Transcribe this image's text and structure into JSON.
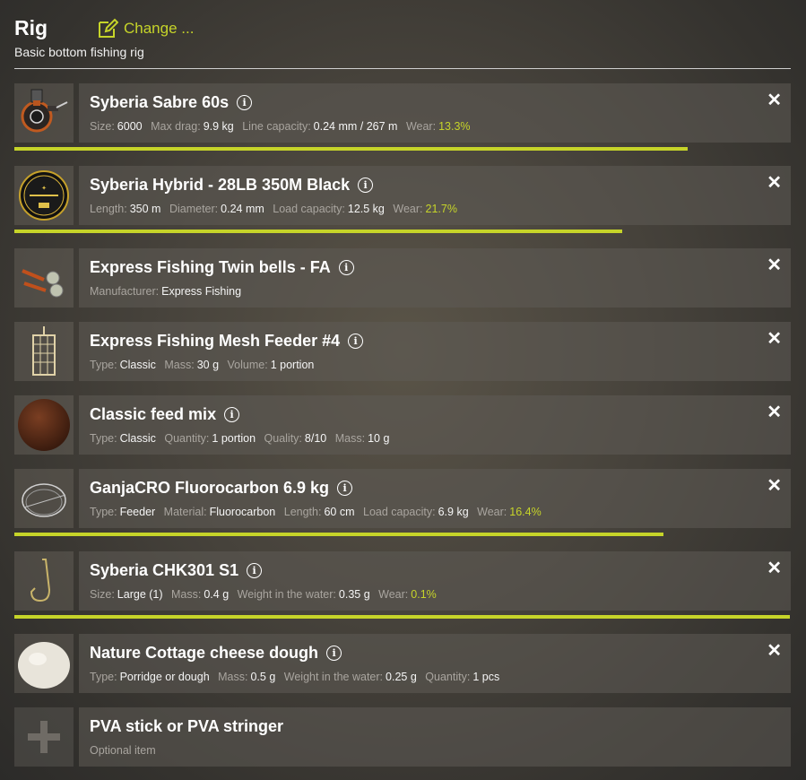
{
  "header": {
    "title": "Rig",
    "change_label": "Change ...",
    "subtitle": "Basic bottom fishing rig"
  },
  "accent_color": "#c6d429",
  "items": [
    {
      "name": "Syberia Sabre 60s",
      "icon": "reel-icon",
      "wear": 0.867,
      "specs": [
        {
          "label": "Size:",
          "value": "6000"
        },
        {
          "label": "Max drag:",
          "value": "9.9 kg"
        },
        {
          "label": "Line capacity:",
          "value": "0.24 mm / 267 m"
        },
        {
          "label": "Wear:",
          "value": "13.3%",
          "wear": true
        }
      ]
    },
    {
      "name": "Syberia Hybrid - 28LB 350M Black",
      "icon": "line-spool-icon",
      "wear": 0.783,
      "specs": [
        {
          "label": "Length:",
          "value": "350 m"
        },
        {
          "label": "Diameter:",
          "value": "0.24 mm"
        },
        {
          "label": "Load capacity:",
          "value": "12.5 kg"
        },
        {
          "label": "Wear:",
          "value": "21.7%",
          "wear": true
        }
      ]
    },
    {
      "name": "Express Fishing Twin bells - FA",
      "icon": "bells-icon",
      "specs": [
        {
          "label": "Manufacturer:",
          "value": "Express Fishing"
        }
      ]
    },
    {
      "name": "Express Fishing Mesh Feeder #4",
      "icon": "feeder-icon",
      "specs": [
        {
          "label": "Type:",
          "value": "Classic"
        },
        {
          "label": "Mass:",
          "value": "30 g"
        },
        {
          "label": "Volume:",
          "value": "1 portion"
        }
      ]
    },
    {
      "name": "Classic feed mix",
      "icon": "feed-mix-icon",
      "specs": [
        {
          "label": "Type:",
          "value": "Classic"
        },
        {
          "label": "Quantity:",
          "value": "1 portion"
        },
        {
          "label": "Quality:",
          "value": "8/10"
        },
        {
          "label": "Mass:",
          "value": "10 g"
        }
      ]
    },
    {
      "name": "GanjaCRO Fluorocarbon 6.9 kg",
      "icon": "leader-icon",
      "wear": 0.836,
      "specs": [
        {
          "label": "Type:",
          "value": "Feeder"
        },
        {
          "label": "Material:",
          "value": "Fluorocarbon"
        },
        {
          "label": "Length:",
          "value": "60 cm"
        },
        {
          "label": "Load capacity:",
          "value": "6.9 kg"
        },
        {
          "label": "Wear:",
          "value": "16.4%",
          "wear": true
        }
      ]
    },
    {
      "name": "Syberia CHK301 S1",
      "icon": "hook-icon",
      "wear": 0.999,
      "specs": [
        {
          "label": "Size:",
          "value": "Large (1)"
        },
        {
          "label": "Mass:",
          "value": "0.4 g"
        },
        {
          "label": "Weight in the water:",
          "value": "0.35 g"
        },
        {
          "label": "Wear:",
          "value": "0.1%",
          "wear": true
        }
      ]
    },
    {
      "name": "Nature Cottage cheese dough",
      "icon": "dough-bait-icon",
      "specs": [
        {
          "label": "Type:",
          "value": "Porridge or dough"
        },
        {
          "label": "Mass:",
          "value": "0.5 g"
        },
        {
          "label": "Weight in the water:",
          "value": "0.25 g"
        },
        {
          "label": "Quantity:",
          "value": "1 pcs"
        }
      ]
    }
  ],
  "empty_slot": {
    "name": "PVA stick or PVA stringer",
    "subtitle": "Optional item",
    "icon": "plus-icon"
  }
}
